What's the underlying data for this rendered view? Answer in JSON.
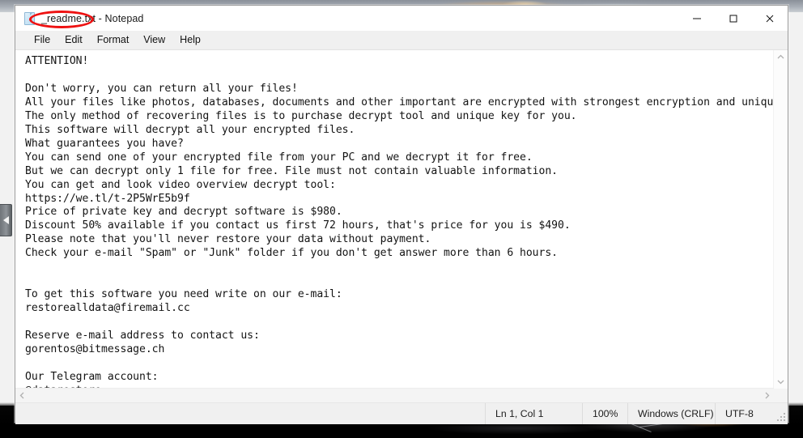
{
  "window": {
    "title": "_readme.txt - Notepad",
    "app_icon": "notepad-document-icon",
    "controls": {
      "minimize": "minimize-icon",
      "maximize": "maximize-icon",
      "close": "close-icon"
    }
  },
  "menubar": {
    "items": [
      {
        "label": "File"
      },
      {
        "label": "Edit"
      },
      {
        "label": "Format"
      },
      {
        "label": "View"
      },
      {
        "label": "Help"
      }
    ]
  },
  "editor": {
    "content": "ATTENTION!\n\nDon't worry, you can return all your files!\nAll your files like photos, databases, documents and other important are encrypted with strongest encryption and unique key.\nThe only method of recovering files is to purchase decrypt tool and unique key for you.\nThis software will decrypt all your encrypted files.\nWhat guarantees you have?\nYou can send one of your encrypted file from your PC and we decrypt it for free.\nBut we can decrypt only 1 file for free. File must not contain valuable information.\nYou can get and look video overview decrypt tool:\nhttps://we.tl/t-2P5WrE5b9f\nPrice of private key and decrypt software is $980.\nDiscount 50% available if you contact us first 72 hours, that's price for you is $490.\nPlease note that you'll never restore your data without payment.\nCheck your e-mail \"Spam\" or \"Junk\" folder if you don't get answer more than 6 hours.\n\n\nTo get this software you need write on our e-mail:\nrestorealldata@firemail.cc\n\nReserve e-mail address to contact us:\ngorentos@bitmessage.ch\n\nOur Telegram account:\n@datarestore",
    "details": {
      "video_url": "https://we.tl/t-2P5WrE5b9f",
      "price_full": "$980",
      "price_discount": "$490",
      "discount_percent": "50%",
      "discount_window_hours": "72 hours",
      "reply_window_hours": "6 hours",
      "primary_email": "restorealldata@firemail.cc",
      "reserve_email": "gorentos@bitmessage.ch",
      "telegram": "@datarestore"
    },
    "scrollbars": {
      "vertical_up": "chevron-up-icon",
      "vertical_down": "chevron-down-icon",
      "horizontal_left": "chevron-left-icon",
      "horizontal_right": "chevron-right-icon"
    }
  },
  "statusbar": {
    "cursor": "Ln 1, Col 1",
    "zoom": "100%",
    "line_ending": "Windows (CRLF)",
    "encoding": "UTF-8"
  },
  "annotation": {
    "shape": "ellipse",
    "color": "#ee1111",
    "targets_text": "_readme.txt -"
  },
  "desktop": {
    "edge_tab_icon": "left-triangle-icon"
  }
}
